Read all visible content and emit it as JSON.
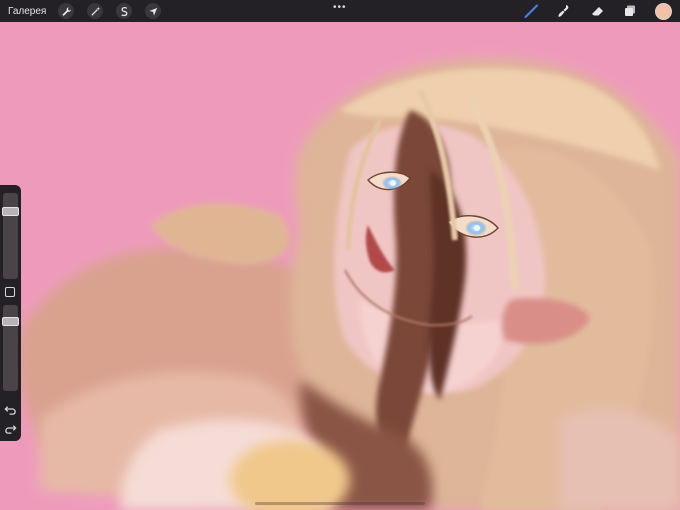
{
  "toolbar": {
    "gallery_label": "Галерея",
    "left_tools": [
      "wrench-icon",
      "magic-wand-icon",
      "selection-icon",
      "transform-arrow-icon"
    ],
    "more_glyph": "•••",
    "right_tools": [
      "brush-icon",
      "smudge-icon",
      "eraser-icon",
      "layers-icon"
    ],
    "current_color": "#f2c2a6"
  },
  "sidebar": {
    "brush_size_level": 0.08,
    "opacity_level": 0.05
  },
  "canvas": {
    "background_color": "#ee9bbb"
  }
}
